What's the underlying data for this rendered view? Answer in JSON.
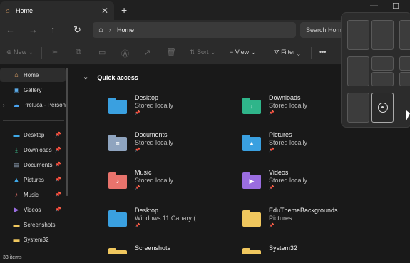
{
  "tab": {
    "title": "Home",
    "close": "✕"
  },
  "new_tab": "+",
  "window_controls": {
    "minimize": "—",
    "maximize": "☐"
  },
  "address": {
    "path": "Home"
  },
  "search": {
    "placeholder": "Search Home"
  },
  "command_bar": {
    "new_label": "New",
    "sort_label": "Sort",
    "view_label": "View",
    "filter_label": "Filter",
    "more_label": "•••"
  },
  "sidebar": {
    "items": [
      {
        "label": "Home",
        "icon": "home-icon",
        "glyph": "⌂",
        "color": "#e8a86a"
      },
      {
        "label": "Gallery",
        "icon": "gallery-icon",
        "glyph": "▣",
        "color": "#5aa9e6"
      },
      {
        "label": "Preluca - Person",
        "icon": "onedrive-icon",
        "glyph": "☁",
        "color": "#4aa3f0"
      },
      {
        "label": "Desktop",
        "icon": "desktop-icon",
        "glyph": "▬",
        "color": "#3fa9e8",
        "pinned": true
      },
      {
        "label": "Downloads",
        "icon": "downloads-icon",
        "glyph": "⤓",
        "color": "#3fbf8f",
        "pinned": true
      },
      {
        "label": "Documents",
        "icon": "documents-icon",
        "glyph": "▤",
        "color": "#9fb4cc",
        "pinned": true
      },
      {
        "label": "Pictures",
        "icon": "pictures-icon",
        "glyph": "▲",
        "color": "#3fa9e8",
        "pinned": true
      },
      {
        "label": "Music",
        "icon": "music-icon",
        "glyph": "♪",
        "color": "#e8736c",
        "pinned": true
      },
      {
        "label": "Videos",
        "icon": "videos-icon",
        "glyph": "▶",
        "color": "#9a6de0",
        "pinned": true
      },
      {
        "label": "Screenshots",
        "icon": "folder-icon",
        "glyph": "▬",
        "color": "#f0c75e"
      },
      {
        "label": "System32",
        "icon": "folder-icon",
        "glyph": "▬",
        "color": "#f0c75e"
      }
    ],
    "pin_glyph": "📌"
  },
  "quick_access": {
    "title": "Quick access",
    "chevron": "⌄",
    "items": [
      {
        "name": "Desktop",
        "sub": "Stored locally",
        "icon": "desktop-folder-icon",
        "color": "#3aa0e0",
        "glyph": ""
      },
      {
        "name": "Downloads",
        "sub": "Stored locally",
        "icon": "downloads-folder-icon",
        "color": "#2fb58a",
        "glyph": "↓"
      },
      {
        "name": "Documents",
        "sub": "Stored locally",
        "icon": "documents-folder-icon",
        "color": "#8fa4bf",
        "glyph": "≡"
      },
      {
        "name": "Pictures",
        "sub": "Stored locally",
        "icon": "pictures-folder-icon",
        "color": "#3aa0e0",
        "glyph": "▲"
      },
      {
        "name": "Music",
        "sub": "Stored locally",
        "icon": "music-folder-icon",
        "color": "#e8736c",
        "glyph": "♪"
      },
      {
        "name": "Videos",
        "sub": "Stored locally",
        "icon": "videos-folder-icon",
        "color": "#9a6de0",
        "glyph": "▶"
      },
      {
        "name": "Desktop",
        "sub": "Windows 11 Canary (...",
        "icon": "desktop-folder-icon",
        "color": "#3aa0e0",
        "glyph": ""
      },
      {
        "name": "EduThemeBackgrounds",
        "sub": "Pictures",
        "icon": "folder-icon",
        "color": "#f0c75e",
        "glyph": ""
      },
      {
        "name": "Screenshots",
        "sub": "",
        "icon": "folder-icon",
        "color": "#f0c75e",
        "glyph": ""
      },
      {
        "name": "System32",
        "sub": "",
        "icon": "folder-icon",
        "color": "#f0c75e",
        "glyph": ""
      }
    ],
    "pin_glyph": "📌"
  },
  "status": {
    "count": "33 items"
  }
}
